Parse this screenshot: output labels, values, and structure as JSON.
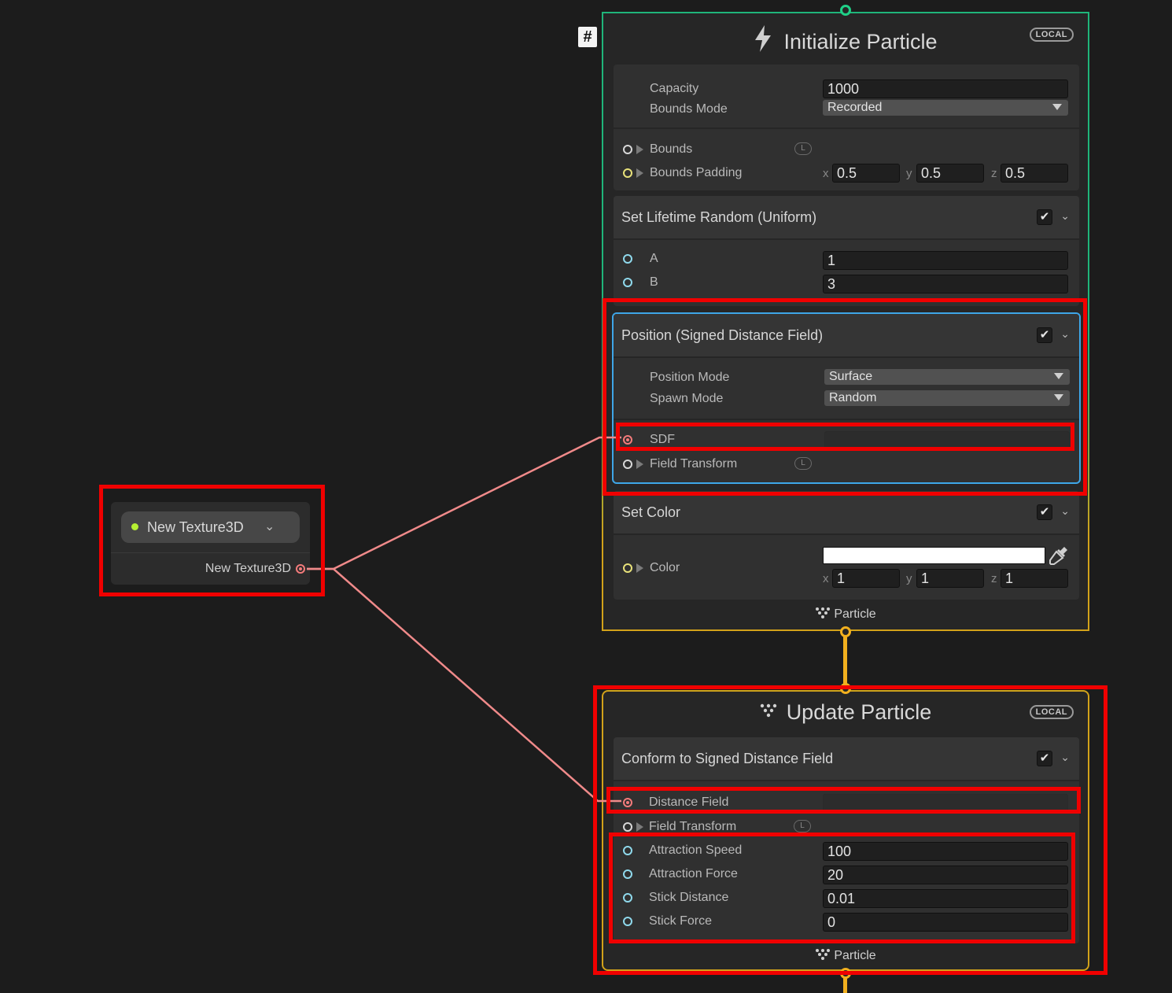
{
  "texture_node": {
    "header_label": "New Texture3D",
    "output_label": "New Texture3D"
  },
  "initialize": {
    "title": "Initialize Particle",
    "badge": "LOCAL",
    "hash": "#",
    "capacity_label": "Capacity",
    "capacity_value": "1000",
    "bounds_mode_label": "Bounds Mode",
    "bounds_mode_value": "Recorded",
    "bounds_label": "Bounds",
    "space_badge": "L",
    "bounds_padding_label": "Bounds Padding",
    "padding": {
      "x_label": "x",
      "x": "0.5",
      "y_label": "y",
      "y": "0.5",
      "z_label": "z",
      "z": "0.5"
    },
    "lifetime_block": {
      "title": "Set Lifetime Random (Uniform)",
      "a_label": "A",
      "a_value": "1",
      "b_label": "B",
      "b_value": "3"
    },
    "position_block": {
      "title": "Position (Signed Distance Field)",
      "position_mode_label": "Position Mode",
      "position_mode_value": "Surface",
      "spawn_mode_label": "Spawn Mode",
      "spawn_mode_value": "Random",
      "sdf_label": "SDF",
      "field_transform_label": "Field Transform"
    },
    "color_block": {
      "title": "Set Color",
      "color_label": "Color",
      "x_label": "x",
      "x": "1",
      "y_label": "y",
      "y": "1",
      "z_label": "z",
      "z": "1",
      "swatch": "#ffffff"
    },
    "flow_label": "Particle"
  },
  "update": {
    "title": "Update Particle",
    "badge": "LOCAL",
    "conform_block": {
      "title": "Conform to Signed Distance Field",
      "distance_field_label": "Distance Field",
      "field_transform_label": "Field Transform",
      "space_badge": "L",
      "attraction_speed_label": "Attraction Speed",
      "attraction_speed_value": "100",
      "attraction_force_label": "Attraction Force",
      "attraction_force_value": "20",
      "stick_distance_label": "Stick Distance",
      "stick_distance_value": "0.01",
      "stick_force_label": "Stick Force",
      "stick_force_value": "0"
    },
    "flow_label": "Particle"
  },
  "colors": {
    "highlight": "#f00000",
    "wire": "#f08a8a",
    "init_border": "#1fb57a",
    "update_border": "#d2a21a",
    "selected_block": "#3ea6e8"
  }
}
